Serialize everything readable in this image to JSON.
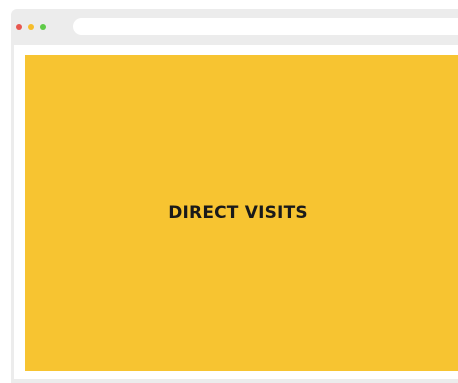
{
  "window": {
    "controls": [
      {
        "name": "close",
        "color": "#e8574f"
      },
      {
        "name": "minimize",
        "color": "#f6bd2b"
      },
      {
        "name": "zoom",
        "color": "#5fcb48"
      }
    ],
    "address_bar": {
      "value": ""
    }
  },
  "page": {
    "panel_color": "#f7c431",
    "label": "DIRECT VISITS"
  }
}
